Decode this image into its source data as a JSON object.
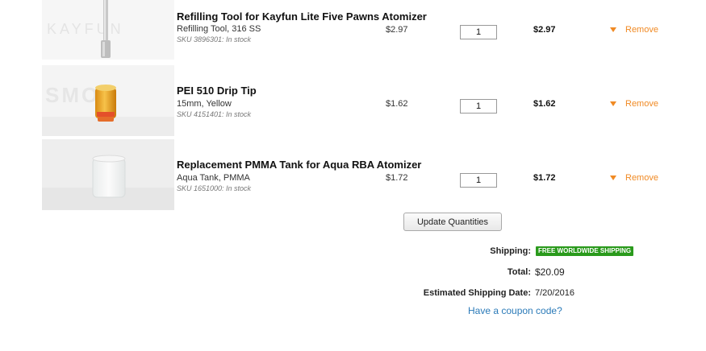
{
  "cart": {
    "items": [
      {
        "name": "Refilling Tool for Kayfun Lite Five Pawns Atomizer",
        "variant": "Refilling Tool, 316 SS",
        "sku": "SKU 3896301: In stock",
        "price": "$2.97",
        "quantity": "1",
        "subtotal": "$2.97",
        "remove_label": "Remove",
        "thumb_icon": "refilling-tool-image"
      },
      {
        "name": "PEI 510 Drip Tip",
        "variant": "15mm, Yellow",
        "sku": "SKU 4151401: In stock",
        "price": "$1.62",
        "quantity": "1",
        "subtotal": "$1.62",
        "remove_label": "Remove",
        "thumb_icon": "drip-tip-image"
      },
      {
        "name": "Replacement PMMA Tank for Aqua RBA Atomizer",
        "variant": "Aqua Tank, PMMA",
        "sku": "SKU 1651000: In stock",
        "price": "$1.72",
        "quantity": "1",
        "subtotal": "$1.72",
        "remove_label": "Remove",
        "thumb_icon": "pmma-tank-image"
      }
    ],
    "update_button": "Update Quantities"
  },
  "summary": {
    "shipping_label": "Shipping:",
    "shipping_badge": "FREE WORLDWIDE SHIPPING",
    "total_label": "Total:",
    "total_value": "$20.09",
    "ship_date_label": "Estimated Shipping Date:",
    "ship_date_value": "7/20/2016",
    "coupon_link": "Have a coupon code?"
  },
  "colors": {
    "accent_orange": "#f08a24",
    "link_blue": "#2a7ab8",
    "badge_green": "#2a9a1c"
  }
}
